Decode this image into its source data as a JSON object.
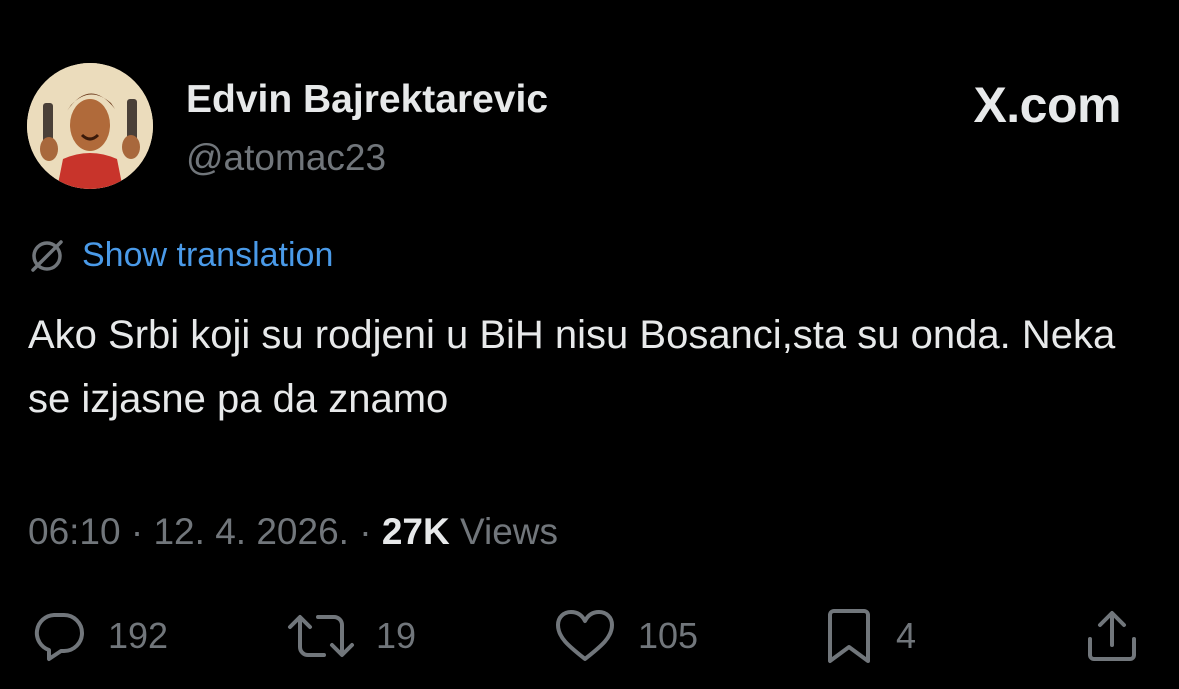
{
  "author": {
    "name": "Edvin Bajrektarevic",
    "handle": "@atomac23"
  },
  "brand": {
    "label": "X.com"
  },
  "translation": {
    "label": "Show translation"
  },
  "tweet": {
    "text": "Ako Srbi koji su rodjeni u BiH nisu Bosanci,sta su onda. Neka se izjasne pa da znamo"
  },
  "meta": {
    "time": "06:10",
    "separator": "·",
    "date": "12. 4. 2026.",
    "views_count": "27K",
    "views_label": "Views"
  },
  "actions": [
    {
      "icon": "reply-icon",
      "count": "192"
    },
    {
      "icon": "retweet-icon",
      "count": "19"
    },
    {
      "icon": "like-icon",
      "count": "105"
    },
    {
      "icon": "bookmark-icon",
      "count": "4"
    },
    {
      "icon": "share-icon",
      "count": ""
    }
  ],
  "colors": {
    "background": "#000000",
    "text": "#e7e9ea",
    "muted": "#71767b",
    "link": "#4a9ae8"
  }
}
